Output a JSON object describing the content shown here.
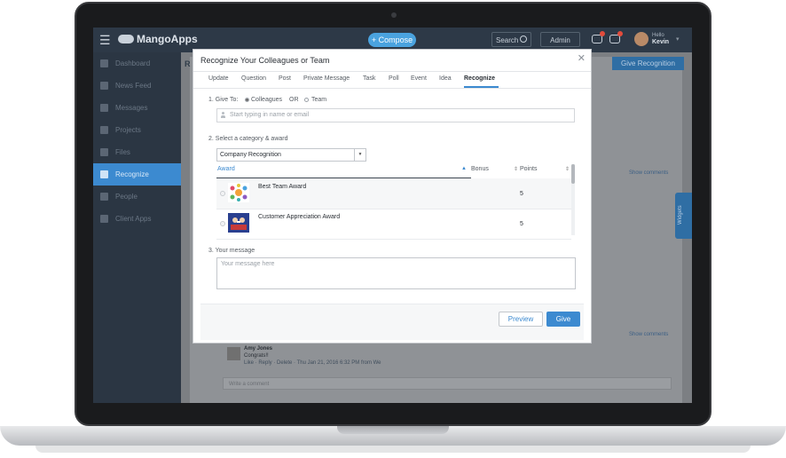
{
  "app": {
    "logo_text": "MangoApps",
    "compose_label": "+ Compose",
    "search_label": "Search",
    "admin_label": "Admin",
    "user_greeting": "Hello",
    "user_name": "Kevin",
    "accent_color": "#3c8ad0",
    "topbar_color": "#2d3947"
  },
  "sidebar": {
    "items": [
      {
        "label": "Dashboard",
        "icon": "home-icon"
      },
      {
        "label": "News Feed",
        "icon": "newsfeed-icon"
      },
      {
        "label": "Messages",
        "icon": "mail-icon"
      },
      {
        "label": "Projects",
        "icon": "folder-icon"
      },
      {
        "label": "Files",
        "icon": "file-icon"
      },
      {
        "label": "Recognize",
        "icon": "trophy-icon",
        "active": true
      },
      {
        "label": "People",
        "icon": "person-icon"
      },
      {
        "label": "Client Apps",
        "icon": "download-icon"
      }
    ]
  },
  "background": {
    "page_letter": "R",
    "give_recognition_label": "Give Recognition",
    "show_comments_label": "Show comments",
    "widgets_label": "Widgets",
    "comment": {
      "author": "Amy Jones",
      "text": "Congrats!!",
      "meta": "Like · Reply · Delete · Thu Jan 21, 2016 6:32 PM from We"
    },
    "write_comment_placeholder": "Write a comment"
  },
  "modal": {
    "title": "Recognize Your Colleagues or Team",
    "tabs": [
      "Update",
      "Question",
      "Post",
      "Private Message",
      "Task",
      "Poll",
      "Event",
      "Idea",
      "Recognize"
    ],
    "active_tab": "Recognize",
    "step1_label": "1. Give To:",
    "option_colleagues": "Colleagues",
    "or_label": "OR",
    "option_team": "Team",
    "name_placeholder": "Start typing in name or email",
    "step2_label": "2. Select a category & award",
    "category_selected": "Company Recognition",
    "table": {
      "headers": {
        "award": "Award",
        "bonus": "Bonus",
        "points": "Points"
      },
      "rows": [
        {
          "name": "Best Team Award",
          "points": "5",
          "icon": "team-award-icon"
        },
        {
          "name": "Customer Appreciation Award",
          "points": "5",
          "icon": "customer-award-icon"
        }
      ]
    },
    "step3_label": "3. Your message",
    "message_placeholder": "Your message here",
    "preview_label": "Preview",
    "give_label": "Give"
  }
}
